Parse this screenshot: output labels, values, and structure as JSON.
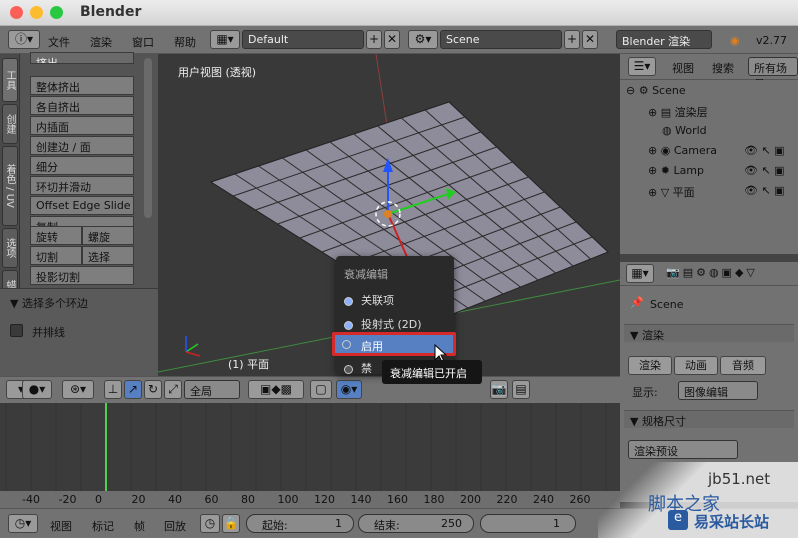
{
  "app_title": "Blender",
  "menu": {
    "file": "文件",
    "render": "渲染",
    "window": "窗口",
    "help": "帮助"
  },
  "layout_field": "Default",
  "scene_field": "Scene",
  "engine_field": "Blender 渲染",
  "version": "v2.77",
  "vtabs": [
    "工具",
    "创建",
    "着色 / UV",
    "选项",
    "蜡笔"
  ],
  "tool_buttons": [
    "挤出",
    "整体挤出",
    "各自挤出",
    "内插面",
    "创建边 / 面",
    "细分",
    "环切并滑动",
    "Offset Edge Slide",
    "复制"
  ],
  "tool_pairs": [
    [
      "旋转",
      "螺旋"
    ],
    [
      "切割",
      "选择"
    ]
  ],
  "tool_last": "投影切割",
  "select_panel": {
    "title": "▼ 选择多个环边",
    "checkbox": "并排线"
  },
  "viewport": {
    "label": "用户视图 (透视)",
    "object": "(1) 平面"
  },
  "outliner": {
    "view": "视图",
    "search": "搜索",
    "all_scenes": "所有场景",
    "scene": "Scene",
    "render_layers": "渲染层",
    "world": "World",
    "camera": "Camera",
    "lamp": "Lamp",
    "plane": "平面"
  },
  "properties": {
    "scene": "Scene",
    "render_section": "渲染",
    "render_btn": "渲染",
    "anim_btn": "动画",
    "audio_btn": "音频",
    "display_label": "显示:",
    "display_value": "图像编辑",
    "dims_section": "规格尺寸",
    "render_preset": "渲染预设"
  },
  "toolbar3d": {
    "pivot": "全局"
  },
  "popup": {
    "title": "衰减编辑",
    "items": [
      "关联项",
      "投射式 (2D)",
      "启用",
      "禁"
    ],
    "selected": 2
  },
  "tooltip": "衰减编辑已开启",
  "ruler_labels": [
    "-40",
    "-20",
    "0",
    "20",
    "40",
    "60",
    "80",
    "100",
    "120",
    "140",
    "160",
    "180",
    "200",
    "220",
    "240",
    "260"
  ],
  "bottom": {
    "view": "视图",
    "marker": "标记",
    "frame": "帧",
    "playback": "回放",
    "start_label": "起始:",
    "start_value": "1",
    "end_label": "结束:",
    "end_value": "250",
    "current": "1"
  },
  "watermark": {
    "site": "jb51.net",
    "name": "脚本之家",
    "brand": "易采站长站"
  },
  "colors": {
    "accent": "#5680c2",
    "highlight_box": "#d62a2a"
  }
}
